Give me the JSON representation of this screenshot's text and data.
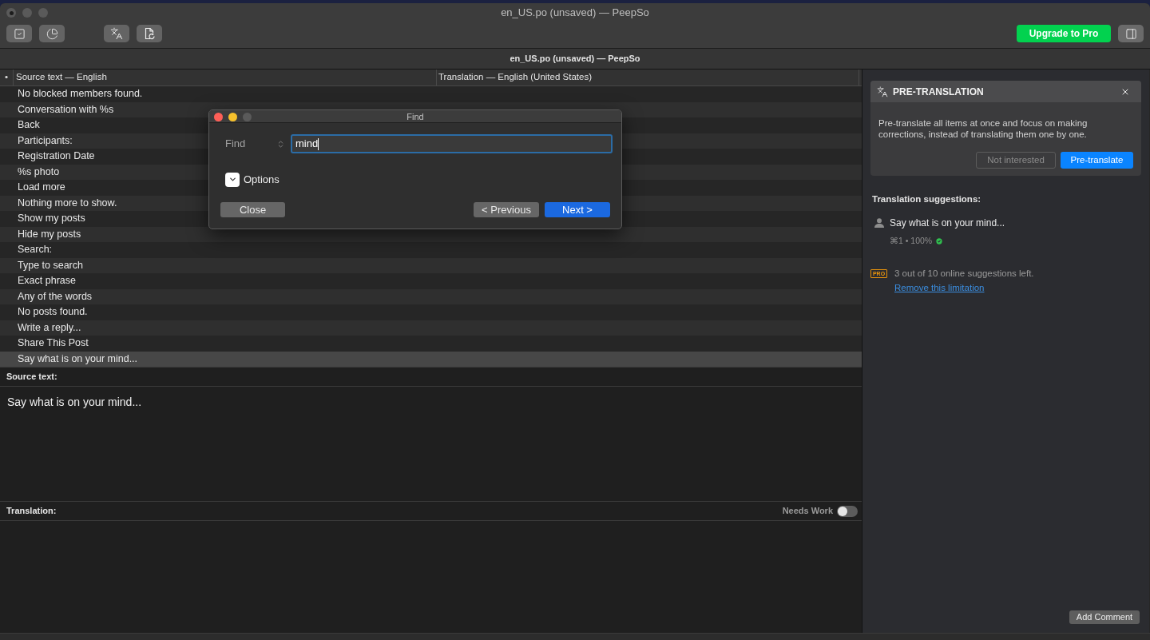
{
  "window": {
    "title": "en_US.po (unsaved) — PeepSo",
    "active": false,
    "edited": true
  },
  "toolbar": {
    "upgrade_button": "Upgrade to Pro"
  },
  "tab_title": "en_US.po (unsaved) — PeepSo",
  "table": {
    "columns": [
      "•",
      "Source text — English",
      "Translation — English (United States)"
    ],
    "rows": [
      {
        "source": "No blocked members found.",
        "selected": false
      },
      {
        "source": "Conversation with %s",
        "selected": false
      },
      {
        "source": "Back",
        "selected": false
      },
      {
        "source": "Participants:",
        "selected": false
      },
      {
        "source": "Registration Date",
        "selected": false
      },
      {
        "source": "%s photo",
        "selected": false
      },
      {
        "source": "Load more",
        "selected": false
      },
      {
        "source": "Nothing more to show.",
        "selected": false
      },
      {
        "source": "Show my posts",
        "selected": false
      },
      {
        "source": "Hide my posts",
        "selected": false
      },
      {
        "source": "Search:",
        "selected": false
      },
      {
        "source": "Type to search",
        "selected": false
      },
      {
        "source": "Exact phrase",
        "selected": false
      },
      {
        "source": "Any of the words",
        "selected": false
      },
      {
        "source": "No posts found.",
        "selected": false
      },
      {
        "source": "Write a reply...",
        "selected": false
      },
      {
        "source": "Share This Post",
        "selected": false
      },
      {
        "source": "Say what is on your mind...",
        "selected": true
      }
    ]
  },
  "source_panel": {
    "label": "Source text:",
    "text": "Say what is on your mind..."
  },
  "translation_panel": {
    "label": "Translation:",
    "needs_work": {
      "label": "Needs Work",
      "on": false
    }
  },
  "sidebar": {
    "pre_translation": {
      "title": "PRE-TRANSLATION",
      "text": "Pre-translate all items at once and focus on making corrections, instead of translating them one by one.",
      "buttons": [
        {
          "label": "Not interested",
          "kind": "secondary"
        },
        {
          "label": "Pre-translate",
          "kind": "primary"
        }
      ]
    },
    "suggestions": {
      "title": "Translation suggestions:",
      "items": [
        {
          "text": "Say what is on your mind...",
          "meta": "⌘1 • 100%"
        }
      ]
    },
    "limit": {
      "badge": "PRO",
      "text": "3 out of 10 online suggestions left.",
      "link": "Remove this limitation"
    },
    "add_comment_button": "Add Comment"
  },
  "find_dialog": {
    "title": "Find",
    "active": true,
    "label": "Find",
    "value": "mind",
    "options": {
      "label": "Options",
      "expanded": false
    },
    "buttons": [
      {
        "label": "Close",
        "kind": "normal"
      },
      {
        "label": "< Previous",
        "kind": "normal"
      },
      {
        "label": "Next >",
        "kind": "default"
      }
    ]
  }
}
